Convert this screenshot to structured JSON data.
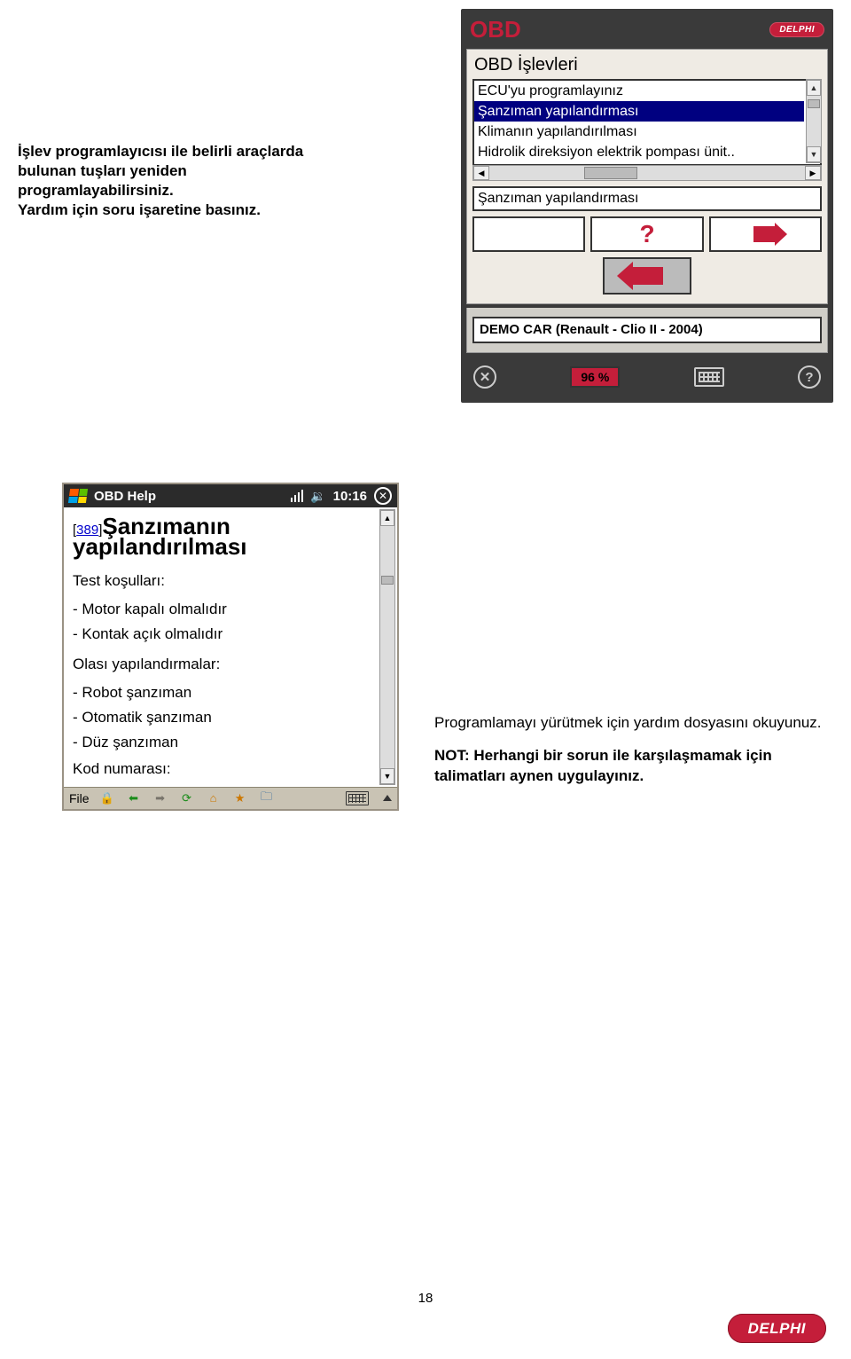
{
  "top_text": {
    "line1": "İşlev programlayıcısı ile belirli araçlarda",
    "line2": "bulunan tuşları yeniden",
    "line3": "programlayabilirsiniz.",
    "line4": "Yardım için soru işaretine basınız."
  },
  "obd": {
    "logo": "OBD",
    "brand": "DELPHI",
    "screen_title": "OBD İşlevleri",
    "list": [
      "ECU'yu programlayınız",
      "Şanzıman yapılandırması",
      "Klimanın yapılandırılması",
      "Hidrolik direksiyon elektrik pompası ünit.."
    ],
    "selected_index": 1,
    "selected_value": "Şanzıman yapılandırması",
    "car_info": "DEMO CAR (Renault - Clio II - 2004)",
    "percent": "96 %"
  },
  "help": {
    "title": "OBD Help",
    "time": "10:16",
    "code": "389",
    "heading_part": "Şanzımanın",
    "heading_line2": "yapılandırılması",
    "section1": "Test koşulları:",
    "bullets": [
      "- Motor kapalı olmalıdır",
      "- Kontak açık olmalıdır"
    ],
    "section2": "Olası yapılandırmalar:",
    "bullets2": [
      "- Robot şanzıman",
      "- Otomatik şanzıman",
      "- Düz şanzıman"
    ],
    "kod": "Kod numarası:",
    "file": "File"
  },
  "bottom_text": {
    "p1": "Programlamayı yürütmek için yardım dosyasını okuyunuz.",
    "p2_pre": "NOT: ",
    "p2": "Herhangi bir sorun ile karşılaşmamak için talimatları aynen uygulayınız."
  },
  "page_number": "18",
  "brand": "DELPHI"
}
